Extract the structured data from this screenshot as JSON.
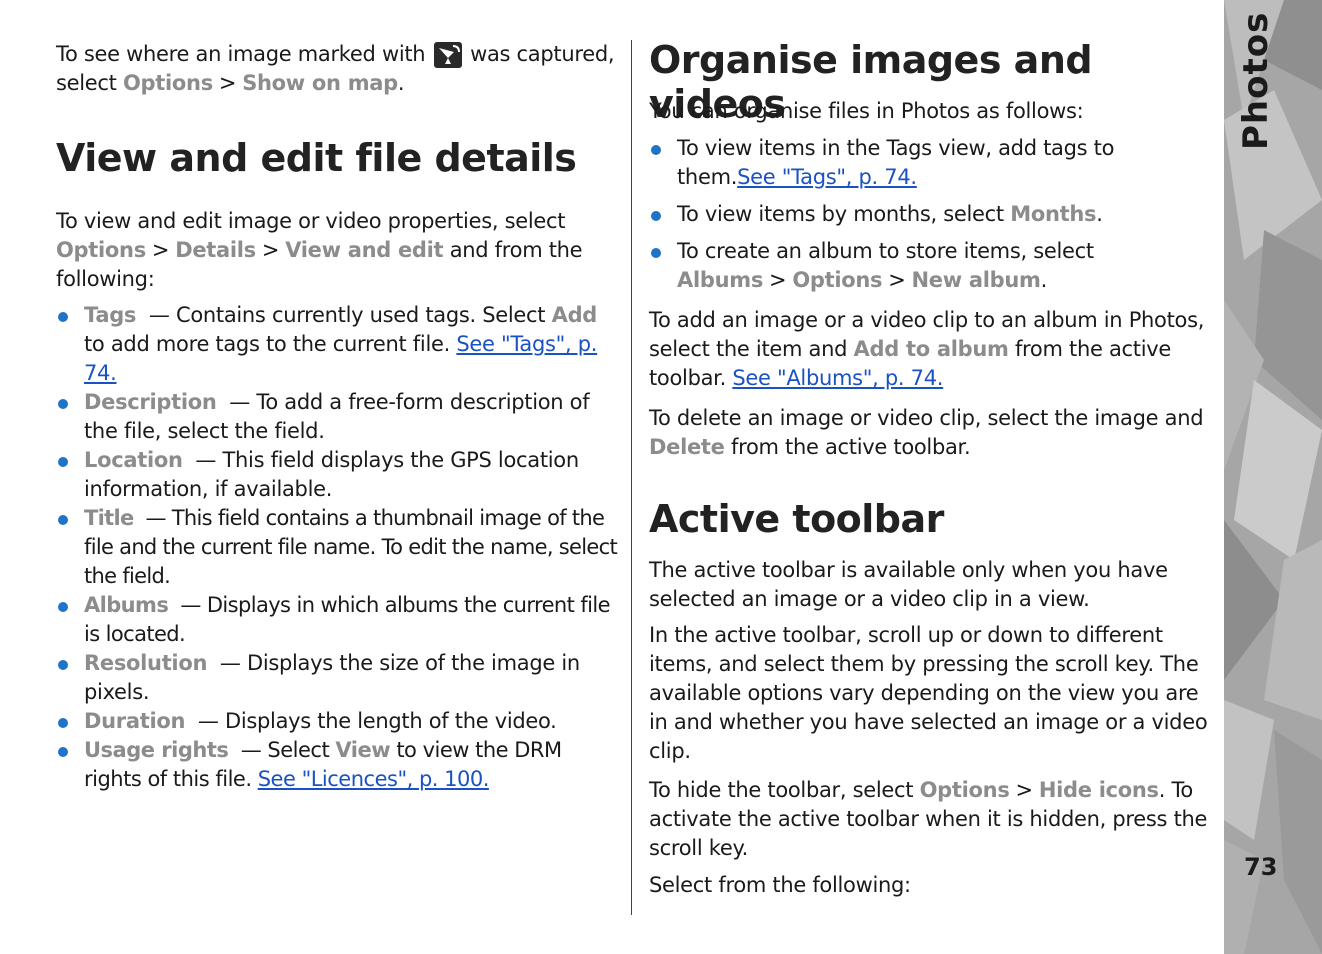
{
  "sidebar": {
    "section_title": "Photos",
    "page_number": "73"
  },
  "left": {
    "intro": {
      "text_before_icon": "To see where an image marked with",
      "icon": "gps-satellite-icon",
      "text_after_icon": "was captured, select",
      "opt1": "Options",
      "separator": ">",
      "opt2": "Show on map",
      "end": "."
    },
    "heading": "View and edit file details",
    "para": {
      "text1": "To view and edit image or video properties, select",
      "opt1": "Options",
      "opt2": "Details",
      "opt3": "View and edit",
      "text2": "and from the following:"
    },
    "items": [
      {
        "term": "Tags",
        "desc": "— Contains currently used tags. Select",
        "opt": "Add",
        "desc2": "to add more tags to the current file.",
        "link": "See \"Tags\", p. 74."
      },
      {
        "term": "Description",
        "desc": "— To add a free-form description of the file, select the field."
      },
      {
        "term": "Location",
        "desc": "— This field displays the GPS location information, if available."
      },
      {
        "term": "Title",
        "desc": "— This field contains a thumbnail image of the file and the current file name. To edit the name, select the field."
      },
      {
        "term": "Albums",
        "desc": "— Displays in which albums the current file is located."
      },
      {
        "term": "Resolution",
        "desc": "— Displays the size of the image in pixels."
      },
      {
        "term": "Duration",
        "desc": "— Displays the length of the video."
      },
      {
        "term": "Usage rights",
        "desc": "— Select",
        "opt": "View",
        "desc2": "to view the DRM rights of this file.",
        "link": "See \"Licences\", p. 100."
      }
    ]
  },
  "right": {
    "heading1": "Organise images and videos",
    "intro": "You can organise files in Photos as follows:",
    "bullets": {
      "b1_text": "To view items in the Tags view, add tags to them.",
      "b1_link": "See \"Tags\", p. 74.",
      "b2_text": "To view items by months, select",
      "b2_opt": "Months",
      "b3_text": "To create an album to store items, select",
      "b3_opt1": "Albums",
      "b3_opt2": "Options",
      "b3_opt3": "New album"
    },
    "p_add": {
      "text1": "To add an image or a video clip to an album in Photos, select the item and",
      "opt": "Add to album",
      "text2": "from the active toolbar.",
      "link": "See \"Albums\", p. 74."
    },
    "p_delete": {
      "text1": "To delete an image or video clip, select the image and",
      "opt": "Delete",
      "text2": "from the active toolbar."
    },
    "heading2": "Active toolbar",
    "p_avail": "The active toolbar is available only when you have selected an image or a video clip in a view.",
    "p_scroll": "In the active toolbar, scroll up or down to different items, and select them by pressing the scroll key. The available options vary depending on the view you are in and whether you have selected an image or a video clip.",
    "p_hide": {
      "text1": "To hide the toolbar, select",
      "opt1": "Options",
      "opt2": "Hide icons",
      "text2": ". To activate the active toolbar when it is hidden, press the scroll key."
    },
    "p_select": "Select from the following:"
  },
  "colors": {
    "option_text": "#8c8c8c",
    "link": "#1a52c4",
    "bullet": "#1f74c8",
    "sidebar": "#a8a8a8"
  }
}
